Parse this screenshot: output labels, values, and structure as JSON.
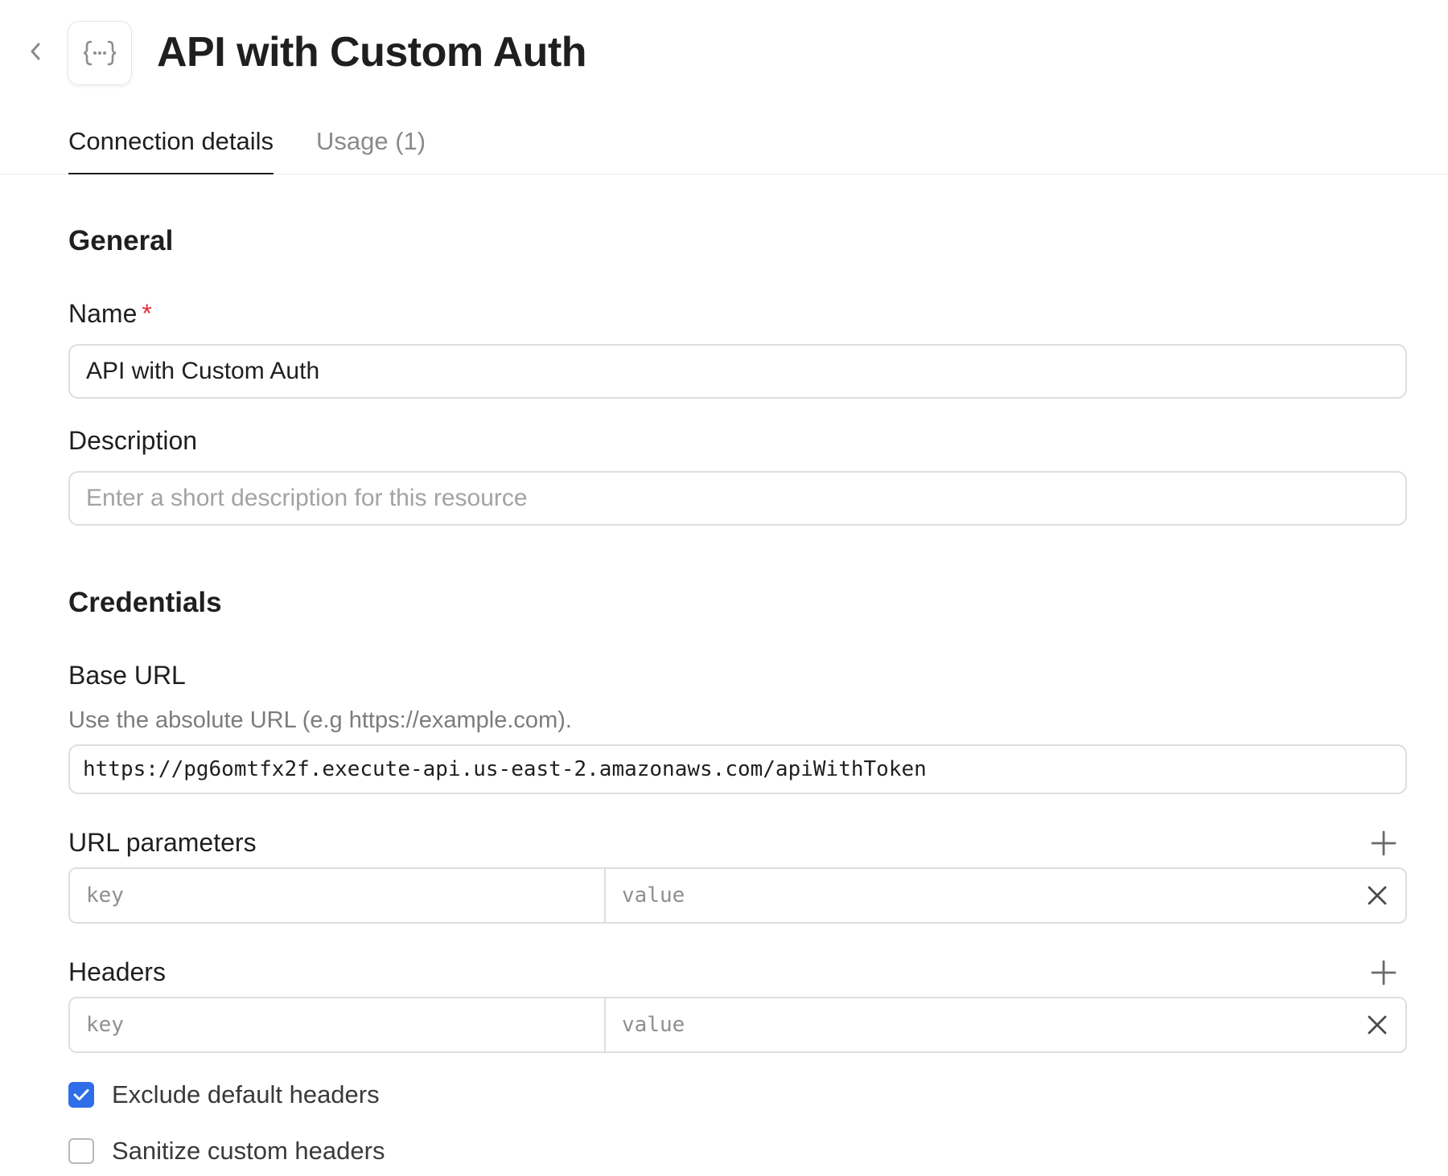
{
  "header": {
    "back_icon": "chevron-left-icon",
    "resource_icon": "api-braces-icon",
    "title": "API with Custom Auth"
  },
  "tabs": [
    {
      "label": "Connection details",
      "active": true
    },
    {
      "label": "Usage (1)",
      "active": false
    }
  ],
  "general": {
    "title": "General",
    "name": {
      "label": "Name",
      "required_marker": "*",
      "value": "API with Custom Auth"
    },
    "description": {
      "label": "Description",
      "placeholder": "Enter a short description for this resource",
      "value": ""
    }
  },
  "credentials": {
    "title": "Credentials",
    "base_url": {
      "label": "Base URL",
      "helper": "Use the absolute URL (e.g https://example.com).",
      "value": "https://pg6omtfx2f.execute-api.us-east-2.amazonaws.com/apiWithToken"
    },
    "url_parameters": {
      "label": "URL parameters",
      "rows": [
        {
          "key_placeholder": "key",
          "value_placeholder": "value"
        }
      ]
    },
    "headers": {
      "label": "Headers",
      "rows": [
        {
          "key_placeholder": "key",
          "value_placeholder": "value"
        }
      ]
    },
    "options": [
      {
        "label": "Exclude default headers",
        "checked": true
      },
      {
        "label": "Sanitize custom headers",
        "checked": false
      }
    ]
  },
  "colors": {
    "accent": "#2f6ee8",
    "required": "#e0303a",
    "border": "#dedede",
    "text": "#1f1f1f",
    "muted": "#8a8a8a"
  }
}
